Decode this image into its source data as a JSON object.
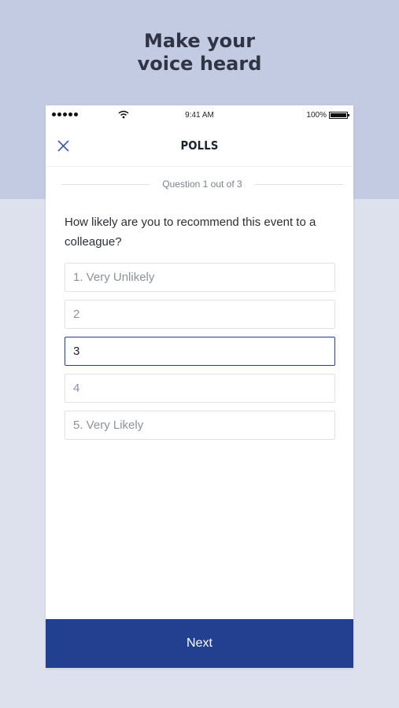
{
  "promo": {
    "headline_line1": "Make your",
    "headline_line2": "voice heard"
  },
  "status_bar": {
    "time": "9:41 AM",
    "battery": "100%"
  },
  "nav": {
    "title": "POLLS",
    "close_icon": "close-icon"
  },
  "poll": {
    "progress_text": "Question 1 out of 3",
    "question": "How likely are you to recommend this event to a colleague?",
    "options": [
      {
        "label": "1. Very Unlikely",
        "selected": false
      },
      {
        "label": "2",
        "selected": false
      },
      {
        "label": "3",
        "selected": true
      },
      {
        "label": "4",
        "selected": false
      },
      {
        "label": "5. Very Likely",
        "selected": false
      }
    ],
    "next_label": "Next"
  },
  "colors": {
    "accent": "#233f8f",
    "top_band": "#c3cbe2",
    "background": "#dde1ee"
  }
}
